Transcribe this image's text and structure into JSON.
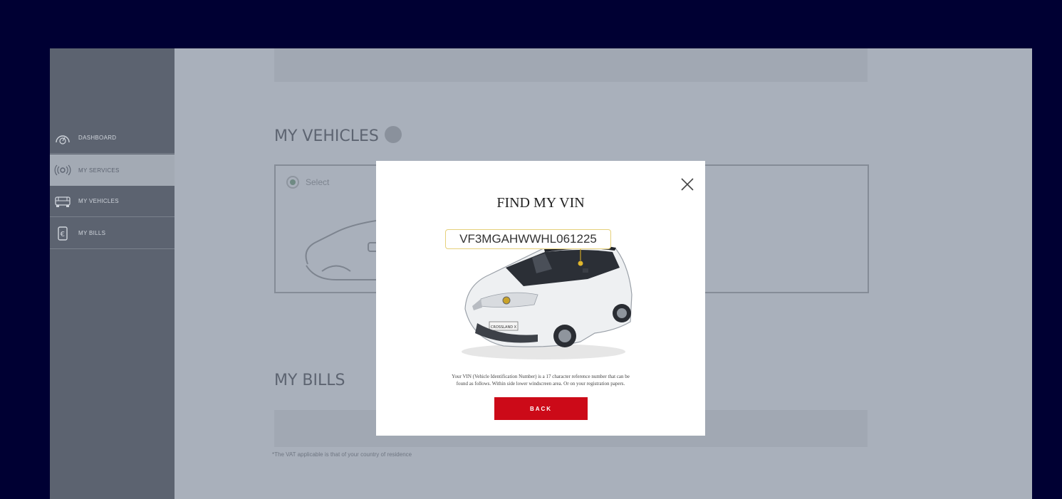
{
  "sidebar": {
    "items": [
      {
        "label": "DASHBOARD",
        "icon": "dashboard-icon",
        "active": false
      },
      {
        "label": "MY SERVICES",
        "icon": "connectivity-icon",
        "active": true
      },
      {
        "label": "MY VEHICLES",
        "icon": "car-icon",
        "active": false
      },
      {
        "label": "MY BILLS",
        "icon": "euro-bill-icon",
        "active": false
      }
    ]
  },
  "main": {
    "vehicles_title": "MY VEHICLES",
    "vehicle_select_label": "Select",
    "bills_title": "MY BILLS",
    "vat_note": "*The VAT applicable is that of your country of residence"
  },
  "modal": {
    "title": "FIND MY VIN",
    "vin_example": "VF3MGAHWWHL061225",
    "description_line1": "Your VIN (Vehicle Identification Number) is a 17 character reference number that can be",
    "description_line2": "found as follows. Within side lower windscreen area. Or on your registration papers.",
    "back_button": "BACK",
    "close_icon": "close-icon",
    "badge_text": "CROSSLAND X"
  },
  "colors": {
    "backdrop": "#000033",
    "overlay_page": "#a9b0bb",
    "sidebar": "#5c6370",
    "accent_red": "#cc0a18"
  }
}
